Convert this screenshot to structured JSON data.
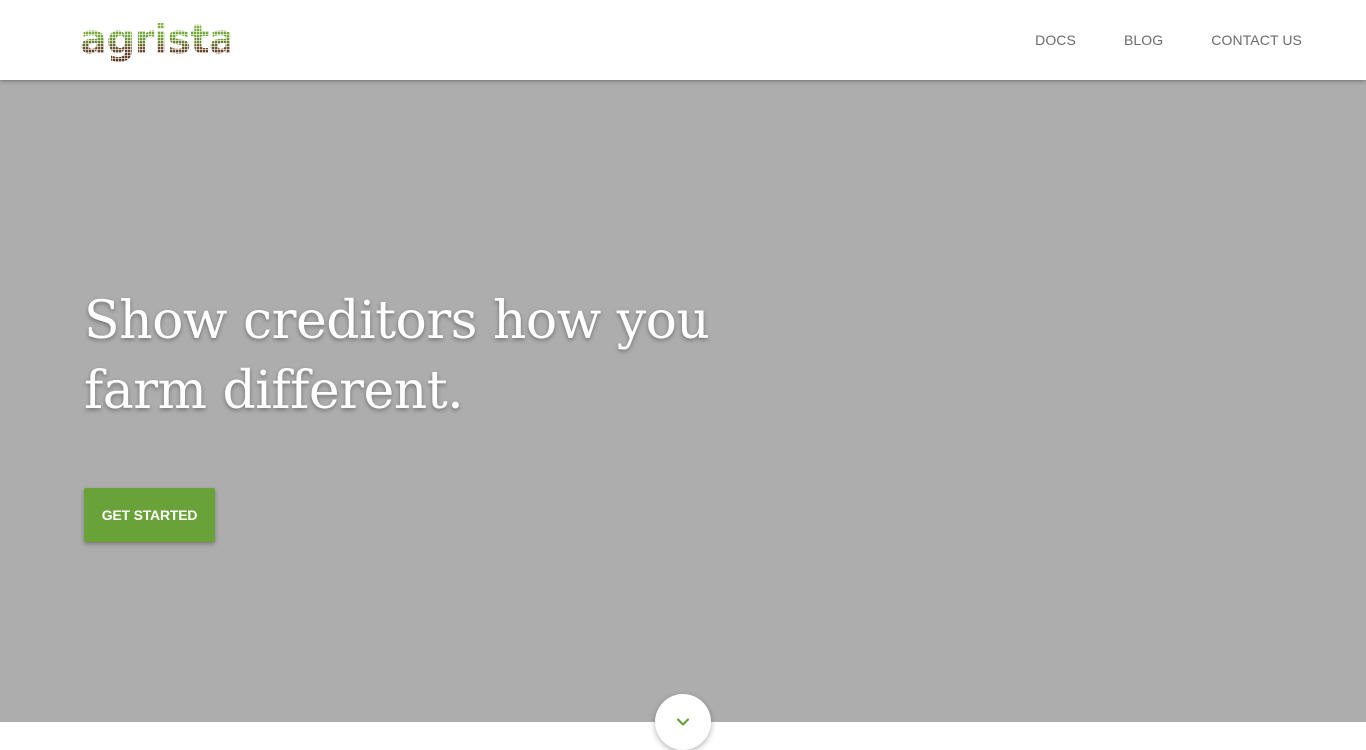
{
  "brand": {
    "logo_text": "agrista",
    "colors": {
      "logo_top": "#7ab13f",
      "logo_bottom": "#6a3f28",
      "accent": "#68a238",
      "hero_bg": "#adadad",
      "nav_text": "#6b6b6b"
    }
  },
  "nav": {
    "items": [
      {
        "label": "DOCS"
      },
      {
        "label": "BLOG"
      },
      {
        "label": "CONTACT US"
      }
    ]
  },
  "hero": {
    "headline_line1": "Show creditors how you",
    "headline_line2": "farm different.",
    "cta_label": "GET STARTED"
  },
  "scroll": {
    "icon": "chevron-down-icon"
  }
}
